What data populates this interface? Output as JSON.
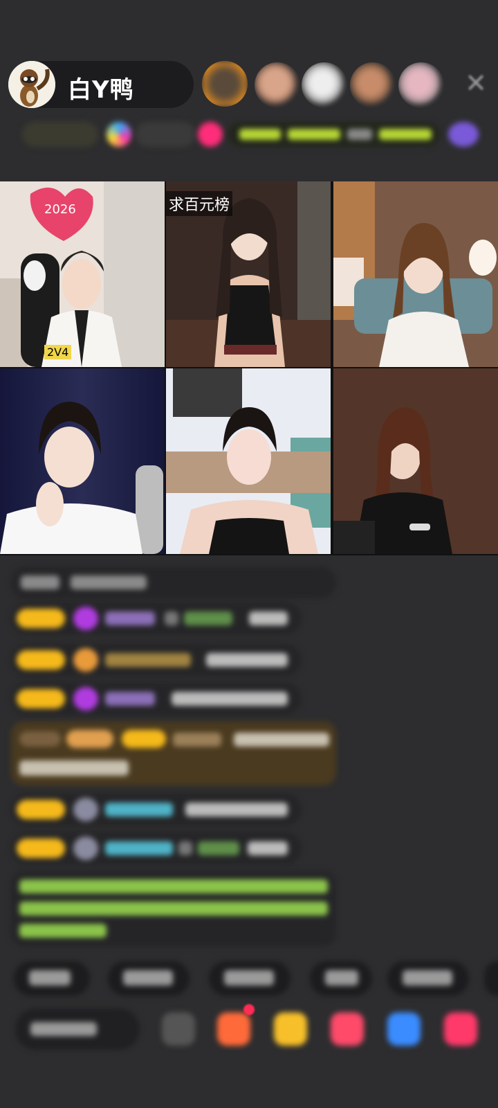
{
  "host": {
    "name": "白Y鸭",
    "avatar_icon": "raccoon-avatar-icon"
  },
  "header": {
    "close_icon": "close-icon",
    "close_glyph": "✕"
  },
  "video_grid": {
    "tiles": [
      {
        "id": 1,
        "tag": "",
        "badge": "2V4"
      },
      {
        "id": 2,
        "tag": "求百元榜",
        "badge": ""
      },
      {
        "id": 3,
        "tag": "",
        "badge": ""
      },
      {
        "id": 4,
        "tag": "",
        "badge": ""
      },
      {
        "id": 5,
        "tag": "",
        "badge": ""
      },
      {
        "id": 6,
        "tag": "",
        "badge": ""
      }
    ]
  },
  "colors": {
    "background": "#2d2d2f",
    "level_badge": "#f5b91b",
    "highlight_msg": "#4a3a1f",
    "accent_green": "#8bc34a",
    "accent_teal": "#4fb3c7"
  }
}
